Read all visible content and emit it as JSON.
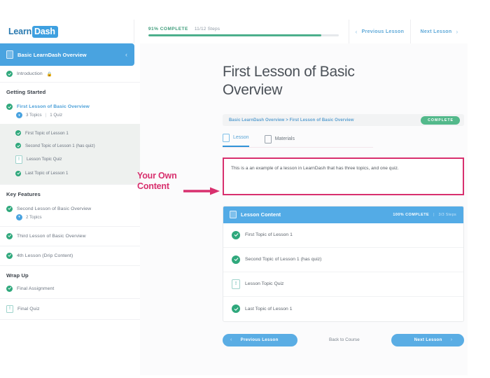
{
  "header": {
    "logo": {
      "first": "Learn",
      "second": "Dash"
    },
    "progress": {
      "percent_label": "91% COMPLETE",
      "steps_label": "11/12 Steps",
      "percent_value": 91
    },
    "prev_button": "Previous Lesson",
    "next_button": "Next Lesson",
    "prev_icon": "chevron-left-icon",
    "next_icon": "chevron-right-icon"
  },
  "sidebar": {
    "course_title": "Basic LearnDash Overview",
    "collapse_icon": "chevron-left-icon",
    "intro": {
      "label": "Introduction",
      "status": "complete",
      "lock_icon": "lock-icon"
    },
    "sections": [
      {
        "title": "Getting Started",
        "lesson": {
          "label": "First Lesson of Basic Overview",
          "status": "complete",
          "meta_topics": "3 Topics",
          "meta_sep": "|",
          "meta_quiz": "1 Quiz"
        },
        "topics": [
          {
            "label": "First Topic of Lesson 1",
            "type": "complete"
          },
          {
            "label": "Second Topic of Lesson 1 (has quiz)",
            "type": "complete"
          },
          {
            "label": "Lesson Topic Quiz",
            "type": "quiz"
          },
          {
            "label": "Last Topic of Lesson 1",
            "type": "complete"
          }
        ]
      }
    ],
    "key_features": {
      "title": "Key Features",
      "items": [
        {
          "label": "Second Lesson of Basic Overview",
          "type": "complete",
          "meta": "2 Topics"
        },
        {
          "label": "Third Lesson of Basic Overview",
          "type": "complete"
        },
        {
          "label": "4th Lesson (Drip Content)",
          "type": "complete"
        }
      ]
    },
    "wrap_up": {
      "title": "Wrap Up",
      "items": [
        {
          "label": "Final Assignment",
          "type": "complete"
        },
        {
          "label": "Final Quiz",
          "type": "quiz"
        }
      ]
    }
  },
  "main": {
    "page_title": "First Lesson of Basic Overview",
    "breadcrumb": "Basic LearnDash Overview > First Lesson of Basic Overview",
    "badge": "COMPLETE",
    "tabs": [
      {
        "label": "Lesson",
        "icon": "document-icon",
        "active": true
      },
      {
        "label": "Materials",
        "icon": "page-icon",
        "active": false
      }
    ],
    "content_text": "This is a an example of a lesson in LearnDash that has three topics, and one quiz.",
    "lesson_card": {
      "title": "Lesson Content",
      "icon": "document-icon",
      "percent_label": "100% COMPLETE",
      "separator": "|",
      "steps_label": "3/3 Steps",
      "rows": [
        {
          "label": "First Topic of Lesson 1",
          "type": "complete"
        },
        {
          "label": "Second Topic of Lesson 1 (has quiz)",
          "type": "complete"
        },
        {
          "label": "Lesson Topic Quiz",
          "type": "quiz"
        },
        {
          "label": "Last Topic of Lesson 1",
          "type": "complete"
        }
      ]
    },
    "bottom_nav": {
      "prev": "Previous Lesson",
      "back": "Back to Course",
      "next": "Next Lesson"
    }
  },
  "annotation": {
    "line1": "Your Own",
    "line2": "Content",
    "color": "#d8306e"
  },
  "colors": {
    "brand_blue": "#49a3e0",
    "accent_blue": "#53abe6",
    "green": "#2fa87c",
    "progress_green": "#4caf8c",
    "annotation_pink": "#d8306e",
    "badge_green": "#53b98b"
  }
}
